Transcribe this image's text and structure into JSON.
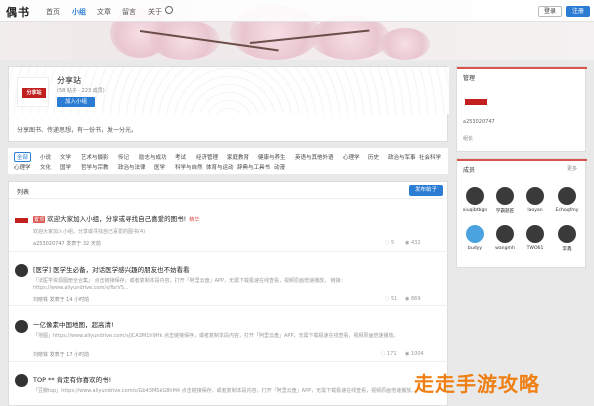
{
  "nav": {
    "logo": "偶书",
    "links": [
      "首页",
      "小组",
      "文章",
      "留言",
      "关于"
    ],
    "login": "登录",
    "register": "注册"
  },
  "group": {
    "avatar_text": "分享站",
    "name": "分享站",
    "stats": "(58 帖子 · 223 成员)",
    "join": "加入小组",
    "description": "分享图书、传递思想，有一份书，发一分光。"
  },
  "tags": [
    "全部",
    "小说",
    "文学",
    "艺术与摄影",
    "传记",
    "励志与成功",
    "考试",
    "经济管理",
    "家庭教育",
    "健康与养生",
    "英语与其他外语",
    "心理学",
    "历史",
    "政治与军事",
    "社会科学",
    "心理学",
    "文化",
    "国学",
    "哲学与宗教",
    "政治与法律",
    "医学",
    "科学与自然",
    "体育与运动",
    "辞典与工具书",
    "动漫"
  ],
  "list": {
    "title": "列表",
    "post_button": "发布帖子",
    "posts": [
      {
        "title": "欢迎大家加入小组，分享或寻找自己喜爱的图书!",
        "badge1": "置顶",
        "badge2": "精华",
        "excerpt": "欢迎大家加入小组，分享或寻找自己喜爱的图书(4)",
        "meta": "a253020747 发表于 32 天前",
        "replies": "5",
        "views": "432"
      },
      {
        "title": "[医学] 医学生必备，对话医学感兴趣的朋友也不妨看看",
        "excerpt": "「法医学资源图册全合集」 点击链接保存，或者复制本段内容，打开「阿里云盘」APP，无需下载极速在线查看，视频原画倍速播放。 链接：",
        "excerpt2": "https://www.aliyundrive.com/s/fbrVS...",
        "meta": "刘晓铁 发表于 14 小时前",
        "replies": "51",
        "views": "869"
      },
      {
        "title": "一亿像素中国地图，超高清!",
        "excerpt": "「地图」https://www.aliyundrive.com/s/JCA3M1h9Hk 点击链接保存，或者复制本段内容，打开「阿里云盘」APP，无需下载极速在线查看，视频原画倍速播放。",
        "meta": "刘晓铁 发表于 17 小时前",
        "replies": "171",
        "views": "1004"
      },
      {
        "title": "TOP ** 肯定有你喜欢的书!",
        "excerpt": "「豆瓣top」https://www.aliyundrive.com/s/Gb43MSkG8hM4 点击链接保存，或者复制本段内容，打开「阿里云盘」APP，无需下载极速在线查看，视频原画倍速播放。",
        "meta": "",
        "replies": "",
        "views": ""
      }
    ]
  },
  "admin": {
    "title": "管理",
    "id": "a253020747",
    "role": "组长"
  },
  "members": {
    "title": "成员",
    "more": "更多",
    "list": [
      "xiuqibtbgn",
      "学霸题匠",
      "laoyan",
      "Echoqfmy",
      "budyy",
      "wangmh",
      "TWO61",
      "李鑫"
    ]
  },
  "watermark": "走走手游攻略"
}
